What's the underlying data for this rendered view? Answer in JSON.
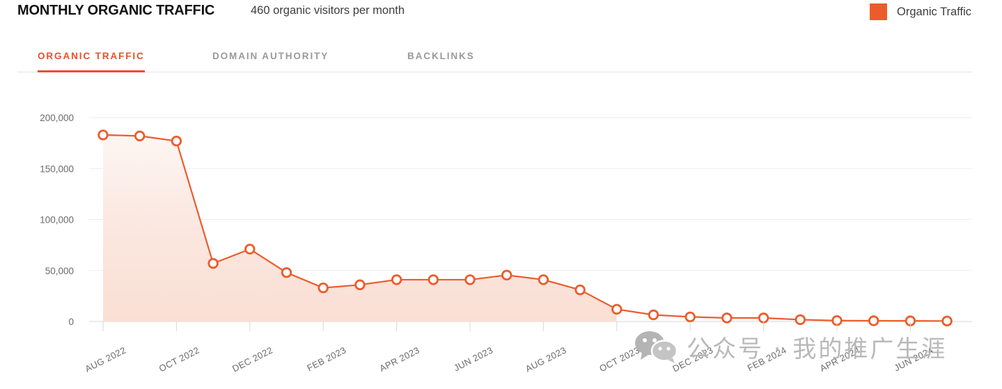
{
  "header": {
    "title": "MONTHLY ORGANIC TRAFFIC",
    "subtitle": "460 organic visitors per month",
    "legend": {
      "label": "Organic Traffic",
      "color": "#ec5c2b"
    }
  },
  "tabs": [
    {
      "label": "ORGANIC TRAFFIC",
      "active": true
    },
    {
      "label": "DOMAIN AUTHORITY",
      "active": false
    },
    {
      "label": "BACKLINKS",
      "active": false
    }
  ],
  "watermark": {
    "text": "公众号 · 我的推广生涯",
    "icon": "wechat-icon"
  },
  "colors": {
    "accent": "#e8512a",
    "line": "#ec5c2b",
    "marker_fill": "#ffffff",
    "area_top": "#fdf4f1",
    "area_bottom": "#fbe2d9",
    "grid": "#ededed",
    "axis": "#d7d7d7",
    "tab_inactive": "#9a9a9a",
    "text": "#3d3d3f"
  },
  "chart_data": {
    "type": "area",
    "title": "MONTHLY ORGANIC TRAFFIC",
    "xlabel": "",
    "ylabel": "",
    "ylim": [
      0,
      200000
    ],
    "yticks": [
      0,
      50000,
      100000,
      150000,
      200000
    ],
    "ytick_labels": [
      "0",
      "50,000",
      "100,000",
      "150,000",
      "200,000"
    ],
    "grid": true,
    "legend_position": "top-right",
    "x": [
      "AUG 2022",
      "SEP 2022",
      "OCT 2022",
      "NOV 2022",
      "DEC 2022",
      "JAN 2023",
      "FEB 2023",
      "MAR 2023",
      "APR 2023",
      "MAY 2023",
      "JUN 2023",
      "JUL 2023",
      "AUG 2023",
      "SEP 2023",
      "OCT 2023",
      "NOV 2023",
      "DEC 2023",
      "JAN 2024",
      "FEB 2024",
      "MAR 2024",
      "APR 2024",
      "MAY 2024",
      "JUN 2024",
      "JUL 2024"
    ],
    "xtick_labels_shown": [
      "AUG 2022",
      "OCT 2022",
      "DEC 2022",
      "FEB 2023",
      "APR 2023",
      "JUN 2023",
      "AUG 2023",
      "OCT 2023",
      "DEC 2023",
      "FEB 2024",
      "APR 2024",
      "JUN 2024"
    ],
    "series": [
      {
        "name": "Organic Traffic",
        "color": "#ec5c2b",
        "values": [
          183000,
          182000,
          177000,
          57000,
          71000,
          48000,
          33000,
          36000,
          41000,
          41000,
          41000,
          45500,
          41000,
          31000,
          12000,
          6500,
          4500,
          3500,
          3500,
          1800,
          900,
          700,
          600,
          460
        ]
      }
    ],
    "annotation": "460 organic visitors per month"
  }
}
